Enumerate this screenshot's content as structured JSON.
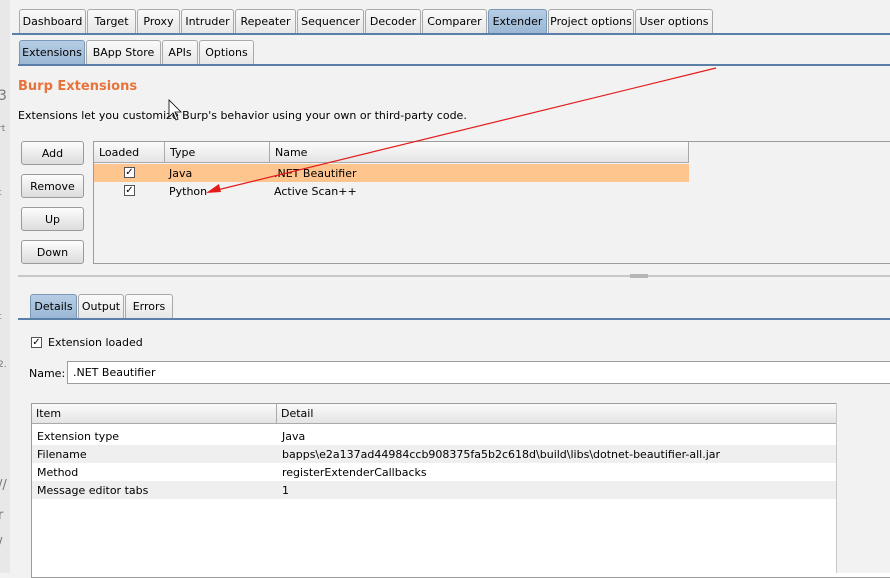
{
  "main_tabs": [
    "Dashboard",
    "Target",
    "Proxy",
    "Intruder",
    "Repeater",
    "Sequencer",
    "Decoder",
    "Comparer",
    "Extender",
    "Project options",
    "User options"
  ],
  "active_main_tab": "Extender",
  "sub_tabs": [
    "Extensions",
    "BApp Store",
    "APIs",
    "Options"
  ],
  "active_sub_tab": "Extensions",
  "section": {
    "title": "Burp Extensions",
    "description": "Extensions let you customize Burp's behavior using your own or third-party code."
  },
  "buttons": {
    "add": "Add",
    "remove": "Remove",
    "up": "Up",
    "down": "Down"
  },
  "extensions_table": {
    "columns": [
      "Loaded",
      "Type",
      "Name"
    ],
    "rows": [
      {
        "loaded": true,
        "type": "Java",
        "name": ".NET Beautifier",
        "selected": true
      },
      {
        "loaded": true,
        "type": "Python",
        "name": "Active Scan++",
        "selected": false
      }
    ]
  },
  "detail_tabs": [
    "Details",
    "Output",
    "Errors"
  ],
  "active_detail_tab": "Details",
  "details": {
    "loaded_label": "Extension loaded",
    "loaded": true,
    "name_label": "Name:",
    "name_value": ".NET Beautifier",
    "columns": [
      "Item",
      "Detail"
    ],
    "rows": [
      {
        "item": "Extension type",
        "detail": "Java"
      },
      {
        "item": "Filename",
        "detail": "bapps\\e2a137ad44984ccb908375fa5b2c618d\\build\\libs\\dotnet-beautifier-all.jar"
      },
      {
        "item": "Method",
        "detail": "registerExtenderCallbacks"
      },
      {
        "item": "Message editor tabs",
        "detail": "1"
      }
    ]
  },
  "colors": {
    "accent_title": "#e8733a",
    "selected_row": "#ffc58f",
    "active_tab": "#9ab7d4",
    "annotation_arrow": "#e31b1b"
  },
  "icons": [
    "checkbox-checked-icon",
    "mouse-cursor-icon",
    "annotation-arrow"
  ]
}
